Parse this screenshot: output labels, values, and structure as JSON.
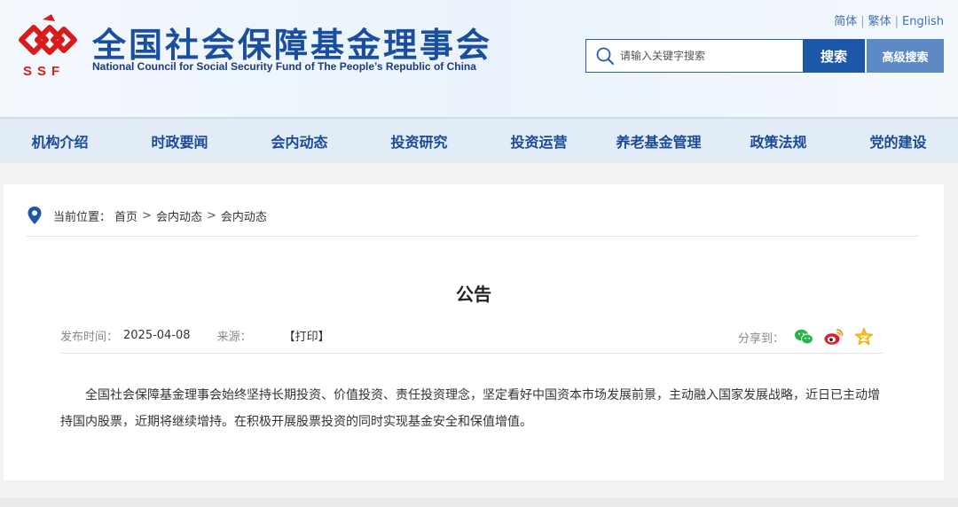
{
  "header": {
    "title": "全国社会保障基金理事会",
    "subtitle": "National Council for Social Security Fund of The People’s Republic of China",
    "logo_text": "SSF",
    "languages": [
      "简体",
      "繁体",
      "English"
    ],
    "search_placeholder": "请输入关键字搜索",
    "search_label": "搜索",
    "advanced_search_label": "高级搜索"
  },
  "nav": {
    "items": [
      "机构介绍",
      "时政要闻",
      "会内动态",
      "投资研究",
      "投资运营",
      "养老基金管理",
      "政策法规",
      "党的建设"
    ]
  },
  "breadcrumb": {
    "label": "当前位置：",
    "items": [
      "首页",
      "会内动态",
      "会内动态"
    ],
    "separator": ">"
  },
  "article": {
    "title": "公告",
    "date_label": "发布时间：",
    "date": "2025-04-08",
    "source_label": "来源：",
    "print_label": "【打印】",
    "share_label": "分享到：",
    "share_icons": [
      "wechat-icon",
      "weibo-icon",
      "qzone-icon"
    ],
    "body": "全国社会保障基金理事会始终坚持长期投资、价值投资、责任投资理念，坚定看好中国资本市场发展前景，主动融入国家发展战略，近日已主动增持国内股票，近期将继续增持。在积极开展股票投资的同时实现基金安全和保值增值。"
  },
  "colors": {
    "brand_blue": "#1a4fa0",
    "logo_red": "#d71c1c",
    "search_button": "#1d58a8",
    "advanced_button": "#5d8ac4",
    "nav_bg": "#e1ecf7"
  }
}
